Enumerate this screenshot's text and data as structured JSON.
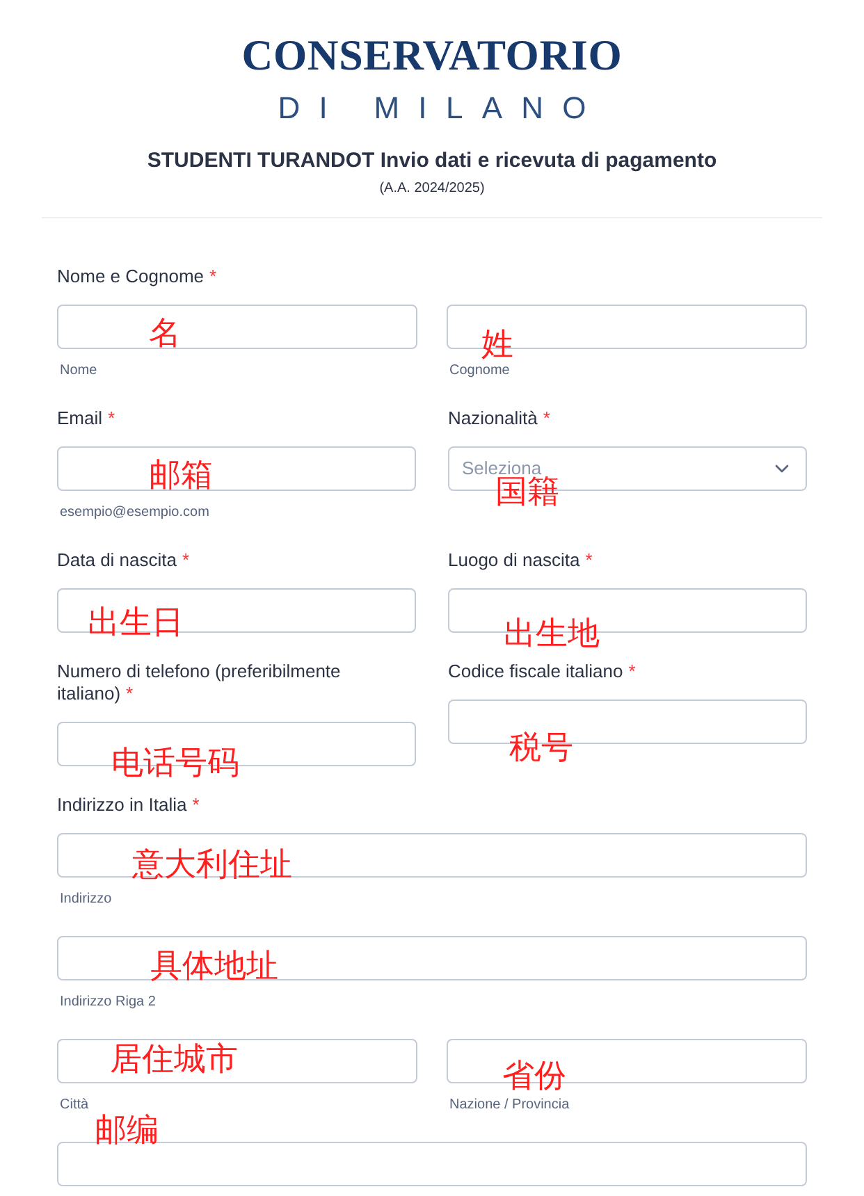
{
  "logo": {
    "line1": "CONSERVATORIO",
    "line2": "DI MILANO"
  },
  "title": "STUDENTI TURANDOT Invio dati e ricevuta di pagamento",
  "subtitle": "(A.A. 2024/2025)",
  "sections": [
    {
      "kind": "group",
      "label": "Nome e Cognome",
      "marker": "*",
      "rows": [
        [
          {
            "kind": "text",
            "sublabel": "Nome",
            "note": "名"
          },
          {
            "kind": "text",
            "sublabel": "Cognome",
            "note": "姓"
          }
        ]
      ]
    },
    {
      "kind": "pair",
      "columns": [
        {
          "label": "Email",
          "marker": "*",
          "input": {
            "kind": "text",
            "sublabel": "esempio@esempio.com",
            "note": "邮箱"
          }
        },
        {
          "label": "Nazionalità",
          "marker": "*",
          "input": {
            "kind": "select",
            "placeholder": "Seleziona",
            "note": "国籍"
          }
        }
      ]
    },
    {
      "kind": "pair",
      "columns": [
        {
          "label": "Data di nascita",
          "marker": "*",
          "input": {
            "kind": "text",
            "note": "出生日"
          }
        },
        {
          "label": "Luogo di nascita",
          "marker": "*",
          "input": {
            "kind": "text",
            "note": "出生地"
          }
        }
      ]
    },
    {
      "kind": "pair",
      "columns": [
        {
          "label": "Numero di telefono (preferibilmente italiano)",
          "marker": "*",
          "input": {
            "kind": "text",
            "note": "电话号码"
          }
        },
        {
          "label": "Codice fiscale italiano",
          "marker": "*",
          "input": {
            "kind": "text",
            "note": "税号"
          }
        }
      ]
    },
    {
      "kind": "group",
      "label": "Indirizzo in Italia",
      "marker": "*",
      "rows": [
        [
          {
            "kind": "text",
            "sublabel": "Indirizzo",
            "note": "意大利住址"
          }
        ],
        [
          {
            "kind": "text",
            "sublabel": "Indirizzo Riga 2",
            "note": "具体地址"
          }
        ],
        [
          {
            "kind": "text",
            "sublabel": "Città",
            "note": "居住城市"
          },
          {
            "kind": "text",
            "sublabel": "Nazione / Provincia",
            "note": "省份"
          }
        ],
        [
          {
            "kind": "text",
            "note": "邮编"
          }
        ]
      ]
    }
  ]
}
